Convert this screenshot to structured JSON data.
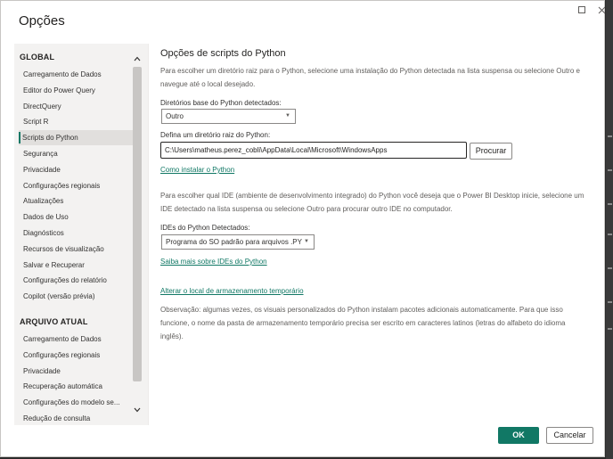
{
  "window": {
    "title": "Opções",
    "maximize_icon": "maximize-icon",
    "close_icon": "close-icon"
  },
  "sidebar": {
    "global_header": "GLOBAL",
    "global_items": [
      {
        "label": "Carregamento de Dados"
      },
      {
        "label": "Editor do Power Query"
      },
      {
        "label": "DirectQuery"
      },
      {
        "label": "Script R"
      },
      {
        "label": "Scripts do Python",
        "selected": true
      },
      {
        "label": "Segurança"
      },
      {
        "label": "Privacidade"
      },
      {
        "label": "Configurações regionais"
      },
      {
        "label": "Atualizações"
      },
      {
        "label": "Dados de Uso"
      },
      {
        "label": "Diagnósticos"
      },
      {
        "label": "Recursos de visualização"
      },
      {
        "label": "Salvar e Recuperar"
      },
      {
        "label": "Configurações do relatório"
      },
      {
        "label": "Copilot (versão prévia)"
      }
    ],
    "current_file_header": "ARQUIVO ATUAL",
    "current_file_items": [
      {
        "label": "Carregamento de Dados"
      },
      {
        "label": "Configurações regionais"
      },
      {
        "label": "Privacidade"
      },
      {
        "label": "Recuperação automática"
      },
      {
        "label": "Configurações do modelo se..."
      },
      {
        "label": "Redução de consulta"
      }
    ]
  },
  "main": {
    "title": "Opções de scripts do Python",
    "intro": "Para escolher um diretório raiz para o Python, selecione uma instalação do Python detectada na lista suspensa ou selecione Outro e navegue até o local desejado.",
    "detected_dirs_label": "Diretórios base do Python detectados:",
    "detected_dirs_value": "Outro",
    "root_dir_label": "Defina um diretório raiz do Python:",
    "root_dir_value": "C:\\Users\\matheus.perez_cobli\\AppData\\Local\\Microsoft\\WindowsApps",
    "browse_button": "Procurar",
    "install_link": "Como instalar o Python",
    "ide_intro": "Para escolher qual IDE (ambiente de desenvolvimento integrado) do Python você deseja que o Power BI Desktop inicie, selecione um IDE detectado na lista suspensa ou selecione Outro para procurar outro IDE no computador.",
    "ide_label": "IDEs do Python Detectados:",
    "ide_value": "Programa do SO padrão para arquivos .PY",
    "ide_link": "Saiba mais sobre IDEs do Python",
    "storage_link": "Alterar o local de armazenamento temporário",
    "note": "Observação: algumas vezes, os visuais personalizados do Python instalam pacotes adicionais automaticamente. Para que isso funcione, o nome da pasta de armazenamento temporário precisa ser escrito em caracteres latinos (letras do alfabeto do idioma inglês)."
  },
  "footer": {
    "ok": "OK",
    "cancel": "Cancelar"
  },
  "colors": {
    "accent": "#117865",
    "selected_bg": "#e1dfdd",
    "sidebar_bg": "#f3f2f1"
  }
}
